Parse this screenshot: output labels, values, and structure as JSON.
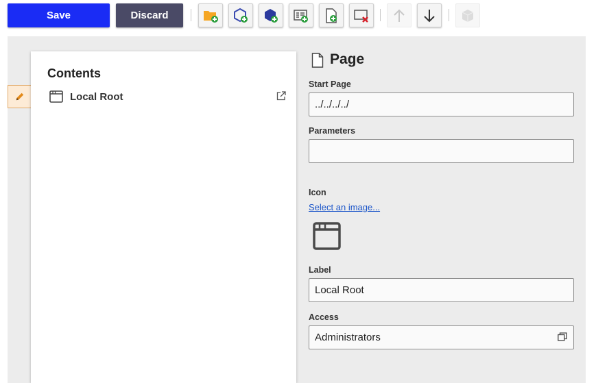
{
  "toolbar": {
    "save_label": "Save",
    "discard_label": "Discard",
    "tools": [
      {
        "name": "add-folder",
        "icon": "folder-add-icon"
      },
      {
        "name": "add-module",
        "icon": "module-add-icon"
      },
      {
        "name": "add-module-dark",
        "icon": "module-dark-add-icon"
      },
      {
        "name": "add-list",
        "icon": "list-add-icon"
      },
      {
        "name": "add-page",
        "icon": "page-add-icon"
      },
      {
        "name": "remove",
        "icon": "remove-icon"
      },
      {
        "name": "move-up",
        "icon": "arrow-up-icon",
        "disabled": true
      },
      {
        "name": "move-down",
        "icon": "arrow-down-icon"
      },
      {
        "name": "package",
        "icon": "box-icon",
        "disabled": true
      }
    ]
  },
  "contents": {
    "title": "Contents",
    "items": [
      {
        "label": "Local Root",
        "icon": "window-icon"
      }
    ]
  },
  "form": {
    "title": "Page",
    "start_page_label": "Start Page",
    "start_page_value": "../../../../",
    "parameters_label": "Parameters",
    "parameters_value": "",
    "icon_label": "Icon",
    "select_image_link": "Select an image...",
    "label_label": "Label",
    "label_value": "Local Root",
    "access_label": "Access",
    "access_value": "Administrators"
  },
  "colors": {
    "primary": "#1a2cf5",
    "secondary": "#4a4a66",
    "workarea": "#ececec",
    "edit_tab": "#fdebd6",
    "link": "#1b55c9"
  }
}
